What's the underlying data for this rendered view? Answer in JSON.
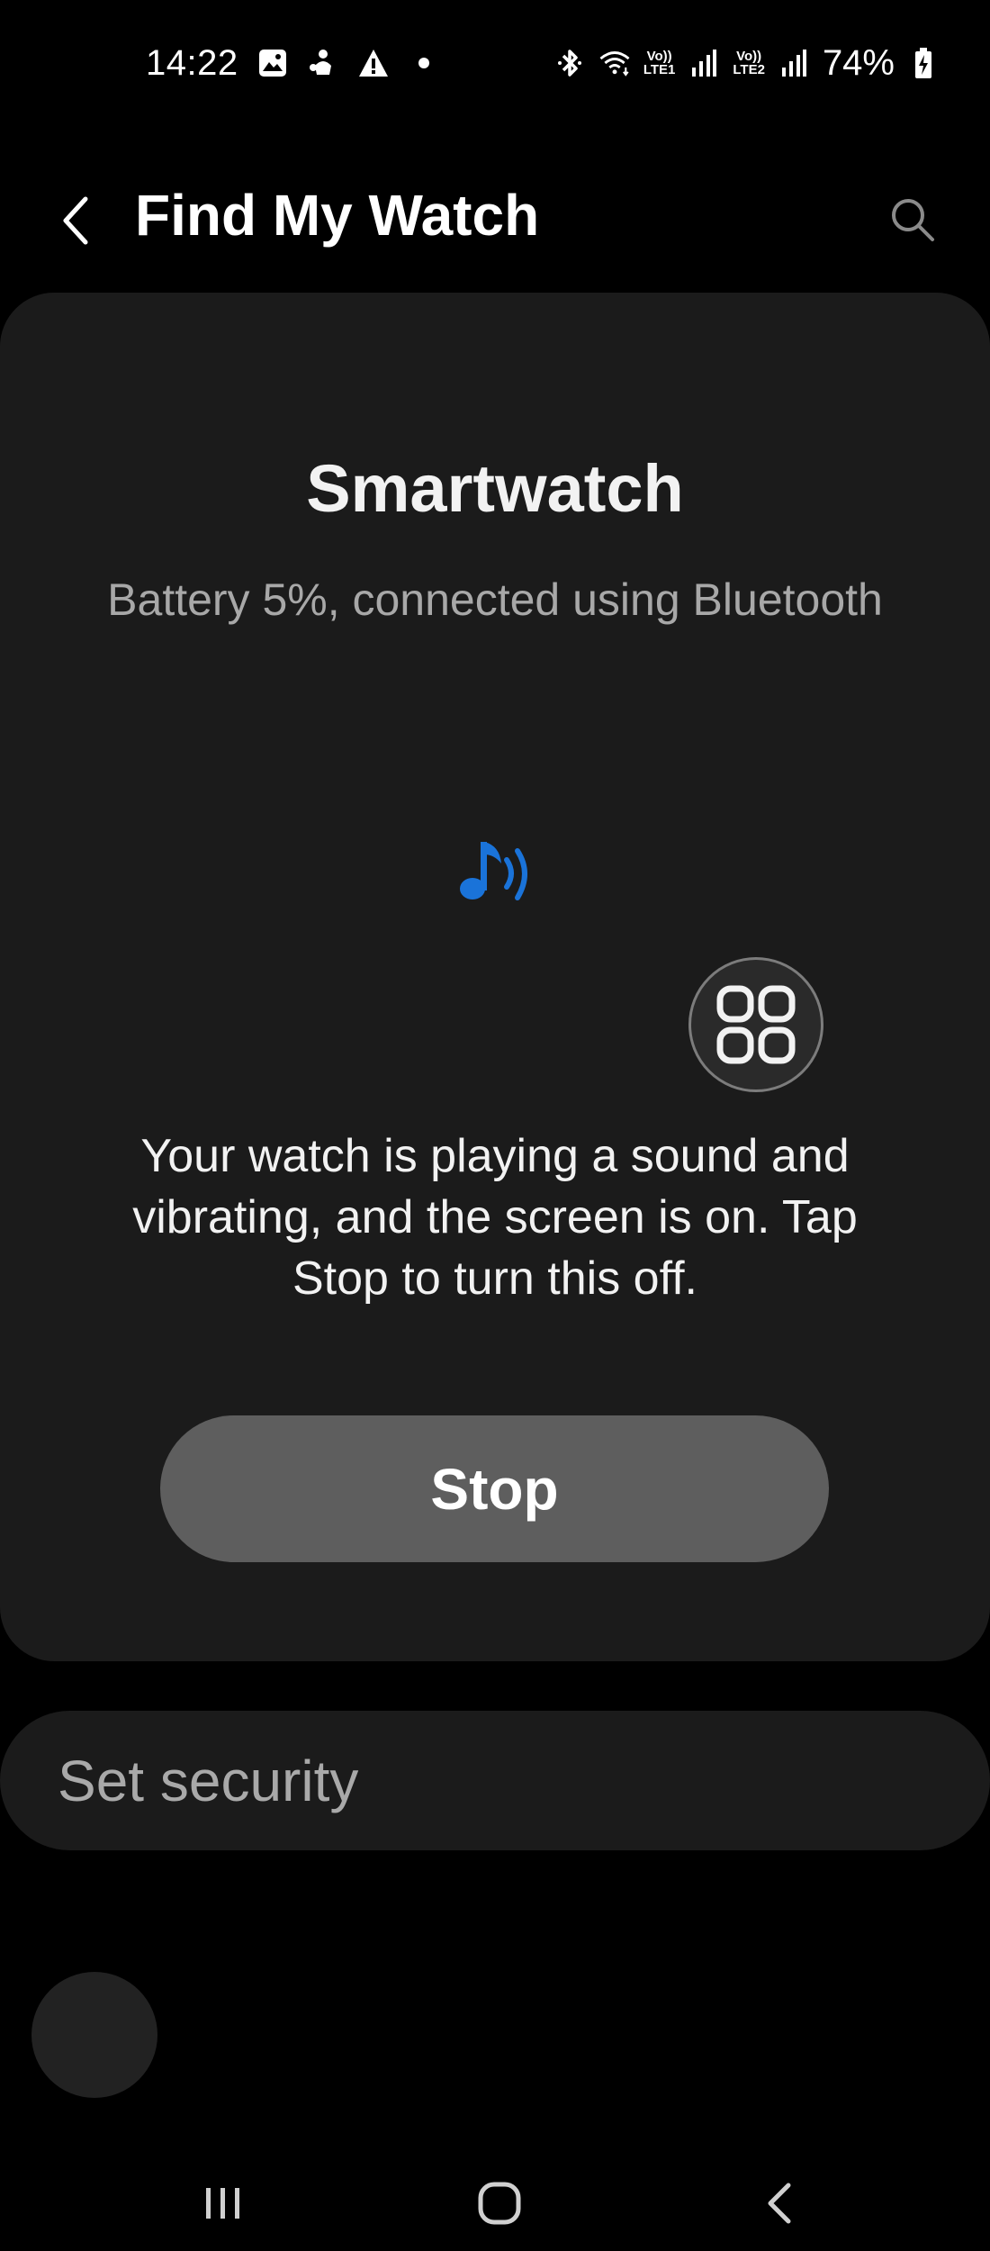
{
  "status_bar": {
    "time": "14:22",
    "net1": {
      "top": "Vo))",
      "bottom": "LTE1"
    },
    "net2": {
      "top": "Vo))",
      "bottom": "LTE2"
    },
    "battery_percent": "74%",
    "icons": [
      "image-icon",
      "notification-app-icon",
      "warning-icon",
      "dot-icon",
      "bluetooth-icon",
      "wifi-icon",
      "signal-icon",
      "battery-charging-icon"
    ]
  },
  "header": {
    "title": "Find My Watch"
  },
  "device": {
    "name": "Smartwatch",
    "status": "Battery 5%, connected using Bluetooth"
  },
  "ringing": {
    "message": "Your watch is playing a sound and vibrating, and the screen is on. Tap Stop to turn this off.",
    "stop_label": "Stop",
    "accent_color": "#1a73d9"
  },
  "security": {
    "label": "Set security"
  }
}
